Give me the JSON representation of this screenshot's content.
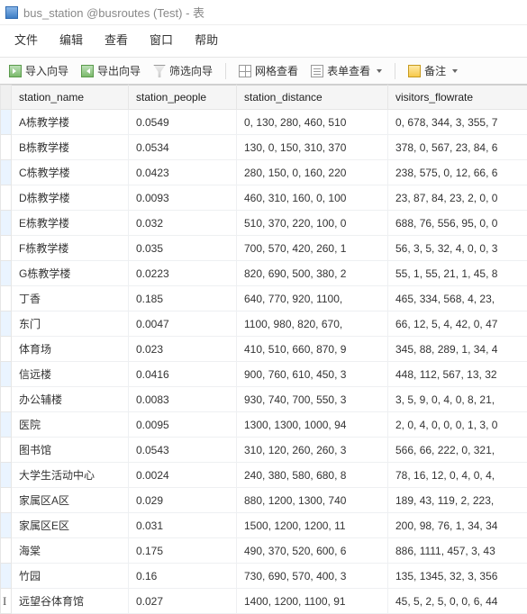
{
  "window": {
    "title": "bus_station @busroutes (Test) - 表"
  },
  "menu": {
    "file": "文件",
    "edit": "编辑",
    "view": "查看",
    "window": "窗口",
    "help": "帮助"
  },
  "toolbar": {
    "import": "导入向导",
    "export": "导出向导",
    "filter": "筛选向导",
    "gridview": "网格查看",
    "formview": "表单查看",
    "note": "备注"
  },
  "columns": {
    "station_name": "station_name",
    "station_people": "station_people",
    "station_distance": "station_distance",
    "visitors_flowrate": "visitors_flowrate"
  },
  "rows": [
    {
      "name": "A栋教学楼",
      "people": "0.0549",
      "dist": "0, 130, 280, 460, 510",
      "flow": "0, 678, 344, 3, 355, 7"
    },
    {
      "name": "B栋教学楼",
      "people": "0.0534",
      "dist": "130, 0, 150, 310, 370",
      "flow": "378, 0, 567, 23, 84, 6"
    },
    {
      "name": "C栋教学楼",
      "people": "0.0423",
      "dist": "280, 150, 0, 160, 220",
      "flow": "238, 575, 0, 12, 66, 6"
    },
    {
      "name": "D栋教学楼",
      "people": "0.0093",
      "dist": "460, 310, 160, 0, 100",
      "flow": "23, 87, 84, 23, 2, 0, 0"
    },
    {
      "name": "E栋教学楼",
      "people": "0.032",
      "dist": "510, 370, 220, 100, 0",
      "flow": "688, 76, 556, 95, 0, 0"
    },
    {
      "name": "F栋教学楼",
      "people": "0.035",
      "dist": "700, 570, 420, 260, 1",
      "flow": "56, 3, 5, 32, 4, 0, 0, 3"
    },
    {
      "name": "G栋教学楼",
      "people": "0.0223",
      "dist": "820, 690, 500, 380, 2",
      "flow": "55, 1, 55, 21, 1, 45, 8"
    },
    {
      "name": "丁香",
      "people": "0.185",
      "dist": "640, 770, 920, 1100, ",
      "flow": "465, 334, 568, 4, 23,"
    },
    {
      "name": "东门",
      "people": "0.0047",
      "dist": "1100, 980, 820, 670, ",
      "flow": "66, 12, 5, 4, 42, 0, 47"
    },
    {
      "name": "体育场",
      "people": "0.023",
      "dist": "410, 510, 660, 870, 9",
      "flow": "345, 88, 289, 1, 34, 4"
    },
    {
      "name": "信远楼",
      "people": "0.0416",
      "dist": "900, 760, 610, 450, 3",
      "flow": "448, 112, 567, 13, 32"
    },
    {
      "name": "办公辅楼",
      "people": "0.0083",
      "dist": "930, 740, 700, 550, 3",
      "flow": "3, 5, 9, 0, 4, 0, 8, 21,"
    },
    {
      "name": "医院",
      "people": "0.0095",
      "dist": "1300, 1300, 1000, 94",
      "flow": "2, 0, 4, 0, 0, 0, 1, 3, 0"
    },
    {
      "name": "图书馆",
      "people": "0.0543",
      "dist": "310, 120, 260, 260, 3",
      "flow": "566, 66, 222, 0, 321,"
    },
    {
      "name": "大学生活动中心",
      "people": "0.0024",
      "dist": "240, 380, 580, 680, 8",
      "flow": "78, 16, 12, 0, 4, 0, 4,"
    },
    {
      "name": "家属区A区",
      "people": "0.029",
      "dist": "880, 1200, 1300, 740",
      "flow": "189, 43, 119, 2, 223,"
    },
    {
      "name": "家属区E区",
      "people": "0.031",
      "dist": "1500, 1200, 1200, 11",
      "flow": "200, 98, 76, 1, 34, 34"
    },
    {
      "name": "海棠",
      "people": "0.175",
      "dist": "490, 370, 520, 600, 6",
      "flow": "886, 1111, 457, 3, 43"
    },
    {
      "name": "竹园",
      "people": "0.16",
      "dist": "730, 690, 570, 400, 3",
      "flow": "135, 1345, 32, 3, 356"
    },
    {
      "name": "远望谷体育馆",
      "people": "0.027",
      "dist": "1400, 1200, 1100, 91",
      "flow": "45, 5, 2, 5, 0, 0, 6, 44"
    }
  ]
}
